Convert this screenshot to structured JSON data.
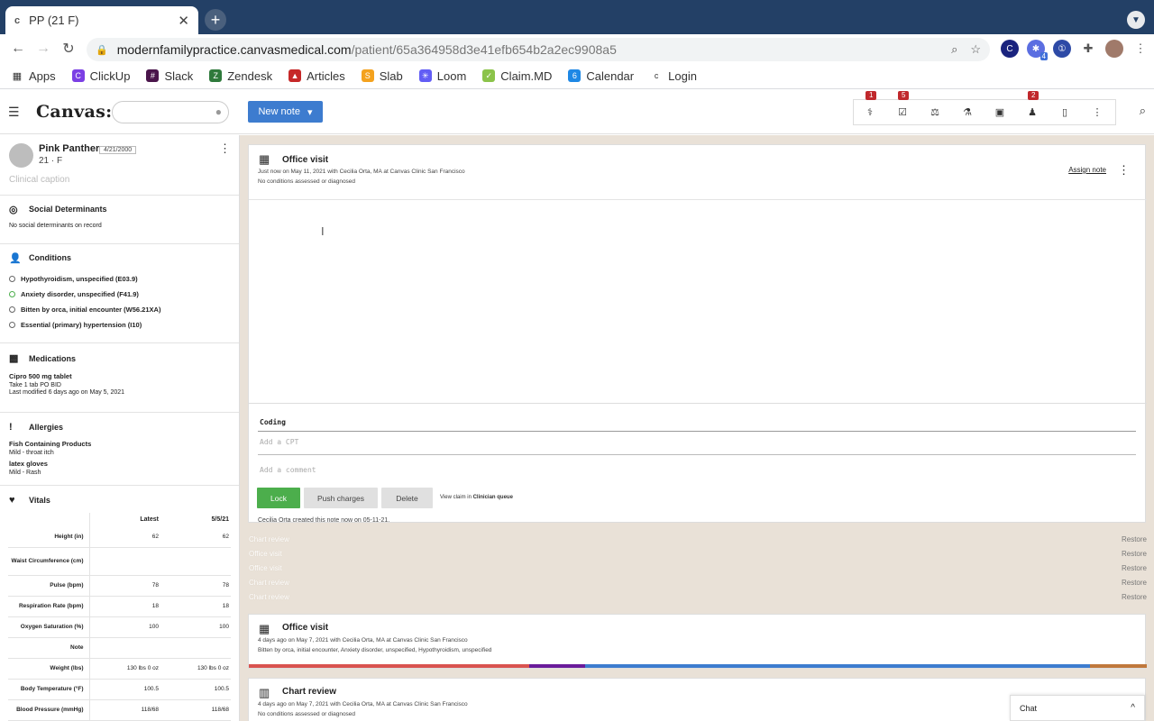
{
  "browser": {
    "tab_title": "PP (21 F)",
    "tab_close": "✕",
    "new_tab": "+",
    "url_host": "modernfamilypractice.canvasmedical.com",
    "url_path": "/patient/65a364958d3e41efb654b2a2ec9908a5",
    "bookmarks": [
      "Apps",
      "ClickUp",
      "Slack",
      "Zendesk",
      "Articles",
      "Slab",
      "Loom",
      "Claim.MD",
      "Calendar",
      "Login"
    ]
  },
  "app": {
    "logo": "Canvas:",
    "new_note_label": "New note",
    "new_note_caret": "▾",
    "icon_counts": {
      "c1": "1",
      "c2": "5",
      "c3": "2"
    }
  },
  "patient": {
    "name": "Pink Panther",
    "dob": "4/21/2000",
    "age_sex": "21 · F",
    "caption_placeholder": "Clinical caption"
  },
  "sidebar": {
    "social": {
      "title": "Social Determinants",
      "empty": "No social determinants on record"
    },
    "conditions": {
      "title": "Conditions",
      "items": [
        "Hypothyroidism, unspecified (E03.9)",
        "Anxiety disorder, unspecified (F41.9)",
        "Bitten by orca, initial encounter (W56.21XA)",
        "Essential (primary) hypertension (I10)"
      ]
    },
    "medications": {
      "title": "Medications",
      "name": "Cipro 500 mg tablet",
      "sig": "Take 1 tab PO BID",
      "modified": "Last modified 6 days ago on May 5, 2021"
    },
    "allergies": {
      "title": "Allergies",
      "items": [
        {
          "name": "Fish Containing Products",
          "detail": "Mild - throat itch"
        },
        {
          "name": "latex gloves",
          "detail": "Mild - Rash"
        }
      ]
    },
    "vitals": {
      "title": "Vitals",
      "col_latest": "Latest",
      "col_date": "5/5/21",
      "rows": [
        {
          "label": "Height (in)",
          "latest": "62",
          "prev": "62"
        },
        {
          "label": "Waist Circumference (cm)",
          "latest": "",
          "prev": ""
        },
        {
          "label": "Pulse (bpm)",
          "latest": "78",
          "prev": "78"
        },
        {
          "label": "Respiration Rate (bpm)",
          "latest": "18",
          "prev": "18"
        },
        {
          "label": "Oxygen Saturation (%)",
          "latest": "100",
          "prev": "100"
        },
        {
          "label": "Note",
          "latest": "",
          "prev": ""
        },
        {
          "label": "Weight (lbs)",
          "latest": "130 lbs 0 oz",
          "prev": "130 lbs 0 oz"
        },
        {
          "label": "Body Temperature (°F)",
          "latest": "100.5",
          "prev": "100.5"
        },
        {
          "label": "Blood Pressure (mmHg)",
          "latest": "118/68",
          "prev": "118/68"
        }
      ]
    }
  },
  "note": {
    "title": "Office visit",
    "meta": "Just now on May 11, 2021 with Cecilia Orta, MA at Canvas Clinic San Francisco",
    "conditions": "No conditions assessed or diagnosed",
    "assign": "Assign note",
    "coding_label": "Coding",
    "cpt_placeholder": "Add a CPT",
    "comment_placeholder": "Add a comment",
    "lock": "Lock",
    "push": "Push charges",
    "delete": "Delete",
    "view_claim_prefix": "View claim in ",
    "view_claim_queue": "Clinician queue",
    "created": "Cecilia Orta created this note now on 05-11-21."
  },
  "deleted_notes": [
    {
      "label": "Chart review",
      "action": "Restore"
    },
    {
      "label": "Office visit",
      "action": "Restore"
    },
    {
      "label": "Office visit",
      "action": "Restore"
    },
    {
      "label": "Chart review",
      "action": "Restore"
    },
    {
      "label": "Chart review",
      "action": "Restore"
    }
  ],
  "past_notes": [
    {
      "title": "Office visit",
      "meta": "4 days ago on May 7, 2021 with Cecilia Orta, MA at Canvas Clinic San Francisco",
      "detail": "Bitten by orca, initial encounter, Anxiety disorder, unspecified, Hypothyroidism, unspecified"
    },
    {
      "title": "Chart review",
      "meta": "4 days ago on May 7, 2021 with Cecilia Orta, MA at Canvas Clinic San Francisco",
      "detail": "No conditions assessed or diagnosed"
    }
  ],
  "chat": {
    "label": "Chat"
  },
  "colors": {
    "accent": "#3d7ccf",
    "lock": "#4cae4c",
    "badge": "#c0282c",
    "tabbar": "#234066",
    "timeline": "#e9e1d7"
  }
}
